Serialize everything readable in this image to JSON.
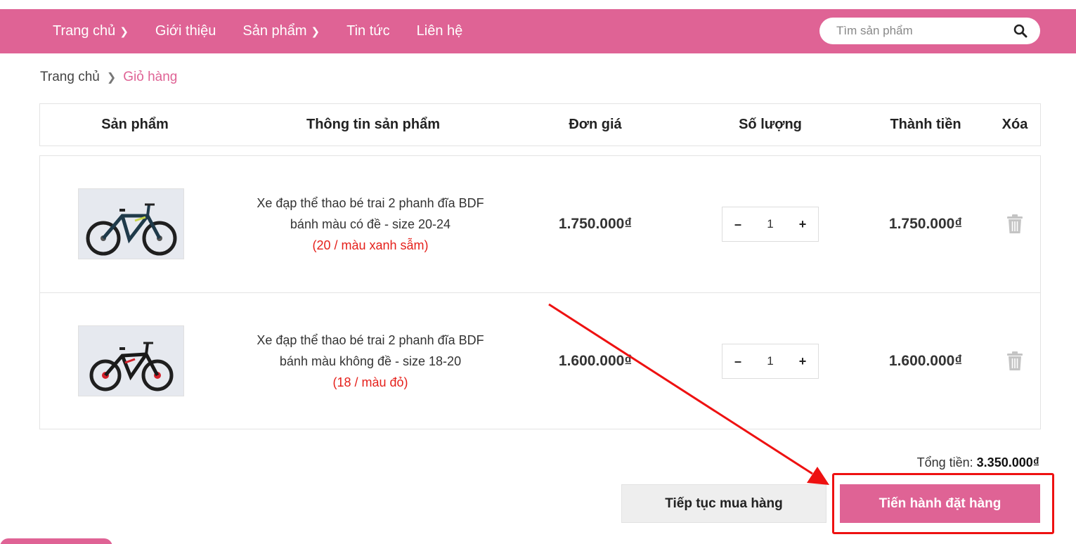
{
  "nav": {
    "items": [
      {
        "label": "Trang chủ",
        "chevron": true
      },
      {
        "label": "Giới thiệu",
        "chevron": false
      },
      {
        "label": "Sản phẩm",
        "chevron": true
      },
      {
        "label": "Tin tức",
        "chevron": false
      },
      {
        "label": "Liên hệ",
        "chevron": false
      }
    ],
    "chevron_glyph": "❯",
    "search_placeholder": "Tìm sản phẩm"
  },
  "breadcrumb": {
    "home": "Trang chủ",
    "separator": "❯",
    "current": "Giỏ hàng"
  },
  "table": {
    "headers": {
      "product": "Sản phẩm",
      "info": "Thông tin sản phẩm",
      "unit_price": "Đơn giá",
      "quantity": "Số lượng",
      "line_total": "Thành tiền",
      "delete": "Xóa"
    },
    "rows": [
      {
        "name_line1": "Xe đạp thể thao bé trai 2 phanh đĩa BDF",
        "name_line2": "bánh màu có đề - size 20-24",
        "variant": "(20 / màu xanh sẫm)",
        "unit_price": "1.750.000₫",
        "quantity": "1",
        "line_total": "1.750.000₫",
        "bike_color": "#1f3a4a",
        "accent_color": "#c8d64a"
      },
      {
        "name_line1": "Xe đạp thể thao bé trai 2 phanh đĩa BDF",
        "name_line2": "bánh màu không đề - size 18-20",
        "variant": "(18 / màu đỏ)",
        "unit_price": "1.600.000₫",
        "quantity": "1",
        "line_total": "1.600.000₫",
        "bike_color": "#1a1a1a",
        "accent_color": "#d4202a"
      }
    ],
    "qty_minus": "–",
    "qty_plus": "+"
  },
  "summary": {
    "label": "Tổng tiền:",
    "value": "3.350.000₫"
  },
  "actions": {
    "continue_label": "Tiếp tục mua hàng",
    "checkout_label": "Tiến hành đặt hàng"
  },
  "colors": {
    "brand_pink": "#df6395",
    "variant_red": "#e5201b",
    "annotation_red": "#ee1111"
  }
}
